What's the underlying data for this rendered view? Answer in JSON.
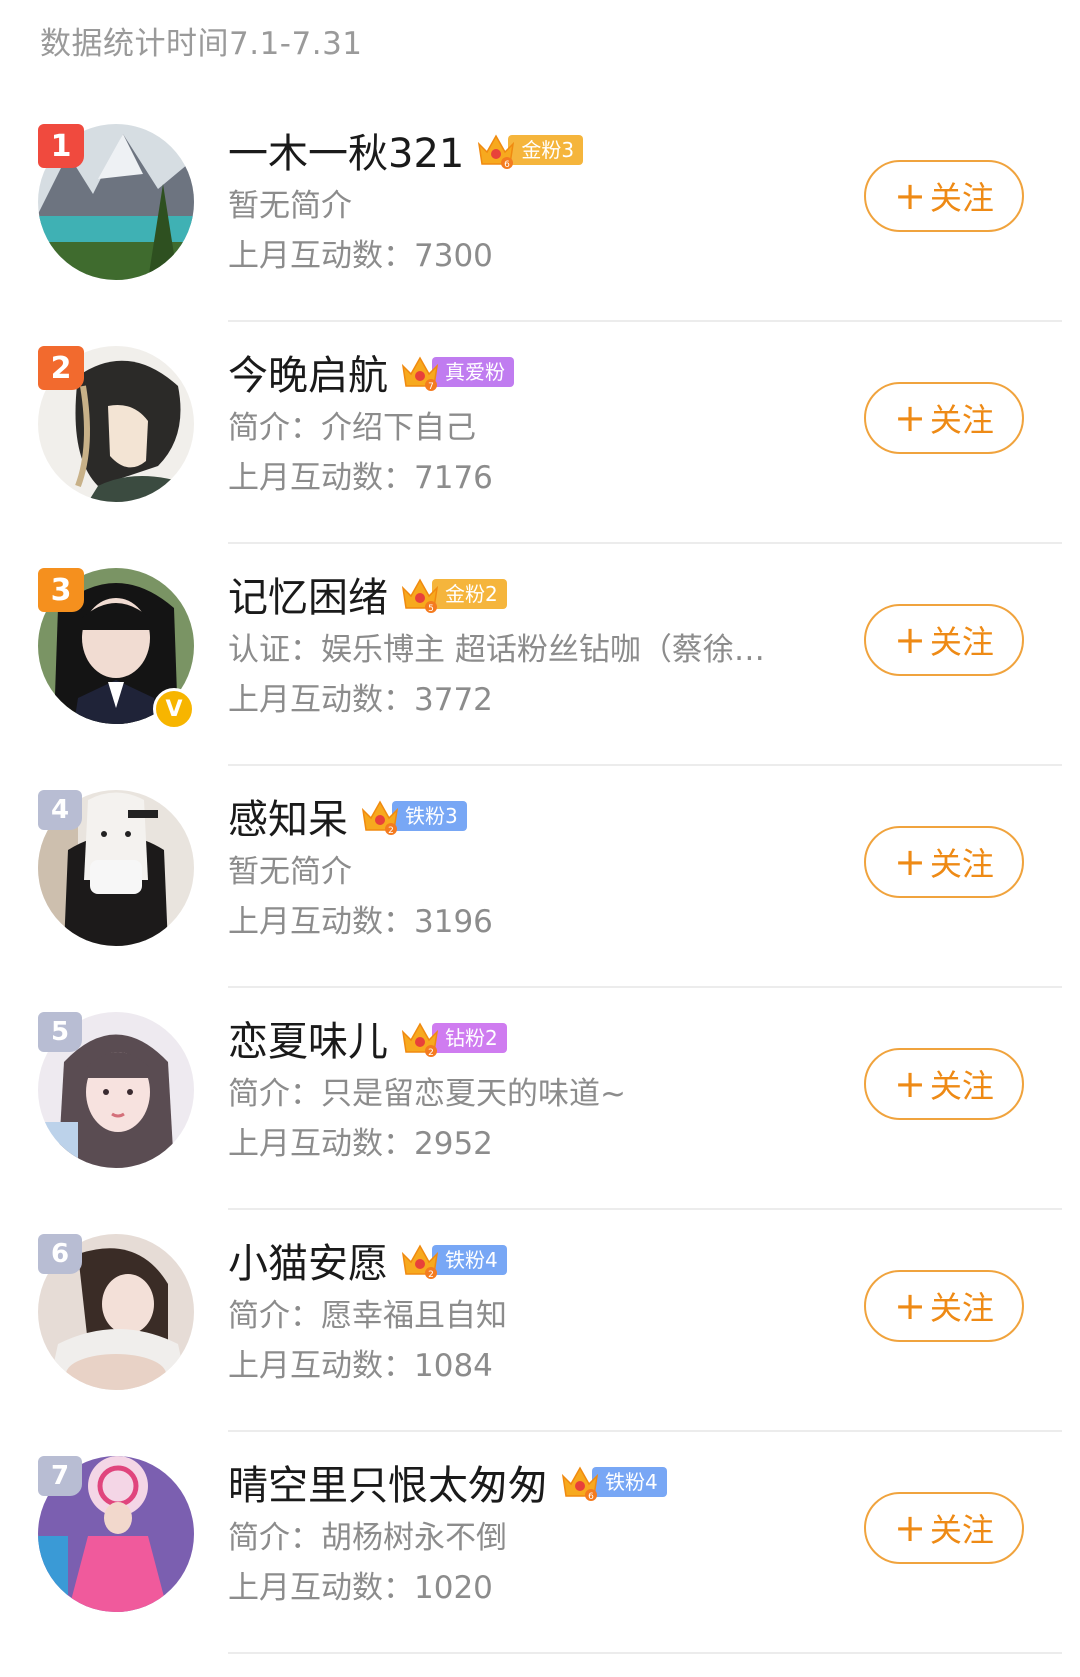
{
  "header": {
    "stat_period": "数据统计时间7.1-7.31"
  },
  "follow_plus": "+",
  "follow_label": "关注",
  "verified_mark": "V",
  "colors": {
    "follow_accent": "#ee8a15",
    "rank_1": "#f04a3e",
    "rank_2": "#f26a2e",
    "rank_3": "#f5901e",
    "rank_other": "#b8bdd3",
    "gold_badge": "#f5b53c",
    "true_love_badge": "#c07cf0",
    "iron_badge": "#78a7f5",
    "diamond_badge": "#cf7cf0"
  },
  "users": [
    {
      "rank": "1",
      "name": "一木一秋321",
      "badge_level": "6",
      "badge": "金粉3",
      "badge_color": "#f5b53c",
      "bio": "暂无简介",
      "interaction": "上月互动数：7300",
      "verified": false,
      "avatar": "mountain-lake-avatar"
    },
    {
      "rank": "2",
      "name": "今晚启航",
      "badge_level": "7",
      "badge": "真爱粉",
      "badge_color": "#c07cf0",
      "bio": "简介：介绍下自己",
      "interaction": "上月互动数：7176",
      "verified": false,
      "avatar": "anime-girl-avatar"
    },
    {
      "rank": "3",
      "name": "记忆困绪",
      "badge_level": "5",
      "badge": "金粉2",
      "badge_color": "#f5b53c",
      "bio": "认证：娱乐博主 超话粉丝钻咖（蔡徐…",
      "interaction": "上月互动数：3772",
      "verified": true,
      "avatar": "girl-uniform-avatar"
    },
    {
      "rank": "4",
      "name": "感知呆",
      "badge_level": "2",
      "badge": "铁粉3",
      "badge_color": "#78a7f5",
      "bio": "暂无简介",
      "interaction": "上月互动数：3196",
      "verified": false,
      "avatar": "bunny-mask-avatar"
    },
    {
      "rank": "5",
      "name": "恋夏味儿",
      "badge_level": "2",
      "badge": "钻粉2",
      "badge_color": "#cf7cf0",
      "bio": "简介：只是留恋夏天的味道~",
      "interaction": "上月互动数：2952",
      "verified": false,
      "avatar": "illustrated-girl-avatar"
    },
    {
      "rank": "6",
      "name": "小猫安愿",
      "badge_level": "2",
      "badge": "铁粉4",
      "badge_color": "#78a7f5",
      "bio": "简介：愿幸福且自知",
      "interaction": "上月互动数：1084",
      "verified": false,
      "avatar": "sleeping-girl-avatar"
    },
    {
      "rank": "7",
      "name": "晴空里只恨太匆匆",
      "badge_level": "6",
      "badge": "铁粉4",
      "badge_color": "#78a7f5",
      "bio": "简介：胡杨树永不倒",
      "interaction": "上月互动数：1020",
      "verified": false,
      "avatar": "pink-dress-avatar"
    }
  ]
}
